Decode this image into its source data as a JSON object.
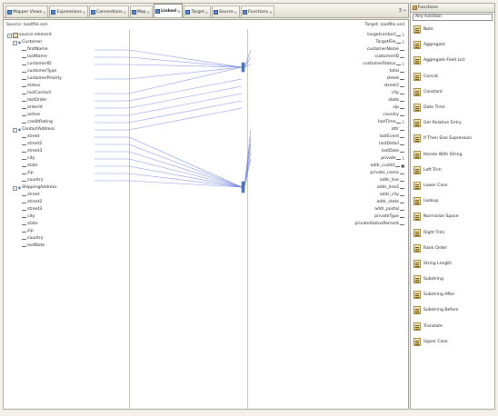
{
  "tabs": [
    {
      "label": "Mapper Views",
      "active": false
    },
    {
      "label": "Expressions",
      "active": false
    },
    {
      "label": "Connections",
      "active": false
    },
    {
      "label": "Map",
      "active": false
    },
    {
      "label": "Linked",
      "active": true
    },
    {
      "label": "Target",
      "active": false
    },
    {
      "label": "Source",
      "active": false
    },
    {
      "label": "Functions",
      "active": false
    }
  ],
  "tabbar_end": {
    "count": "3",
    "overflow": "»"
  },
  "source": {
    "header": "Source: loadfile.xsd",
    "rows": [
      {
        "kind": "root",
        "toggle": "-",
        "label": "source element"
      },
      {
        "kind": "group",
        "toggle": "-",
        "label": "Customer"
      },
      {
        "kind": "leaf",
        "label": "firstName"
      },
      {
        "kind": "leaf",
        "label": "lastName"
      },
      {
        "kind": "leaf",
        "label": "customerID"
      },
      {
        "kind": "leaf",
        "label": "customerType"
      },
      {
        "kind": "leaf",
        "label": "customerPriority"
      },
      {
        "kind": "leaf",
        "label": "status"
      },
      {
        "kind": "leaf",
        "label": "lastContact"
      },
      {
        "kind": "leaf",
        "label": "lastOrder"
      },
      {
        "kind": "leaf",
        "label": "orderId"
      },
      {
        "kind": "leaf",
        "label": "active"
      },
      {
        "kind": "leaf",
        "label": "creditRating"
      },
      {
        "kind": "group",
        "toggle": "-",
        "label": "ContactAddress"
      },
      {
        "kind": "leaf",
        "label": "street"
      },
      {
        "kind": "leaf",
        "label": "street2"
      },
      {
        "kind": "leaf",
        "label": "street3"
      },
      {
        "kind": "leaf",
        "label": "city"
      },
      {
        "kind": "leaf",
        "label": "state"
      },
      {
        "kind": "leaf",
        "label": "zip"
      },
      {
        "kind": "leaf",
        "label": "country"
      },
      {
        "kind": "group",
        "toggle": "-",
        "label": "ShippingAddress"
      },
      {
        "kind": "leaf",
        "label": "street"
      },
      {
        "kind": "leaf",
        "label": "street2"
      },
      {
        "kind": "leaf",
        "label": "street3"
      },
      {
        "kind": "leaf",
        "label": "city"
      },
      {
        "kind": "leaf",
        "label": "state"
      },
      {
        "kind": "leaf",
        "label": "zip"
      },
      {
        "kind": "leaf",
        "label": "country"
      },
      {
        "kind": "leaf",
        "label": "lastNote"
      }
    ]
  },
  "target": {
    "header": "Target: loadfile.xsd",
    "rows": [
      {
        "label": "targetcontact",
        "badge": "1"
      },
      {
        "label": "TargetFile",
        "badge": "1"
      },
      {
        "label": "customerName",
        "badge": ""
      },
      {
        "label": "customerID",
        "badge": ""
      },
      {
        "label": "customerStatus",
        "badge": "1"
      },
      {
        "label": "total",
        "badge": ""
      },
      {
        "label": "street",
        "badge": ""
      },
      {
        "label": "street2",
        "badge": ""
      },
      {
        "label": "city",
        "badge": ""
      },
      {
        "label": "state",
        "badge": ""
      },
      {
        "label": "zip",
        "badge": ""
      },
      {
        "label": "country",
        "badge": ""
      },
      {
        "label": "lastTime",
        "badge": "1"
      },
      {
        "label": "attr",
        "badge": ""
      },
      {
        "label": "lastEvent",
        "badge": ""
      },
      {
        "label": "lastDetail",
        "badge": ""
      },
      {
        "label": "lastDate",
        "badge": ""
      },
      {
        "label": "private",
        "badge": "1"
      },
      {
        "label": "addr_custid",
        "badge": "■"
      },
      {
        "label": "private_name",
        "badge": ""
      },
      {
        "label": "addr_line",
        "badge": ""
      },
      {
        "label": "addr_line2",
        "badge": ""
      },
      {
        "label": "addr_city",
        "badge": ""
      },
      {
        "label": "addr_state",
        "badge": ""
      },
      {
        "label": "addr_postal",
        "badge": ""
      },
      {
        "label": "privateType",
        "badge": ""
      },
      {
        "label": "privateStatusRemark",
        "badge": ""
      }
    ]
  },
  "palette": {
    "title": "Functions",
    "search_value": "Any function",
    "items": [
      "Note",
      "Aggregate",
      "Aggregate Field List",
      "Concat",
      "Constant",
      "Date Time",
      "Get Relative Entry",
      "If Then Else Expression",
      "Iterate With String",
      "Left Trim",
      "Lower Case",
      "Lookup",
      "Normalize Space",
      "Right Trim",
      "Rank Order",
      "String Length",
      "Substring",
      "Substring After",
      "Substring Before",
      "Translate",
      "Upper Case"
    ]
  },
  "colors": {
    "background": "#f3f1ea",
    "panel": "#ffffff",
    "border": "#a7a598",
    "mapping_line": "#5a6fd6",
    "hub": "#4a74b8"
  }
}
